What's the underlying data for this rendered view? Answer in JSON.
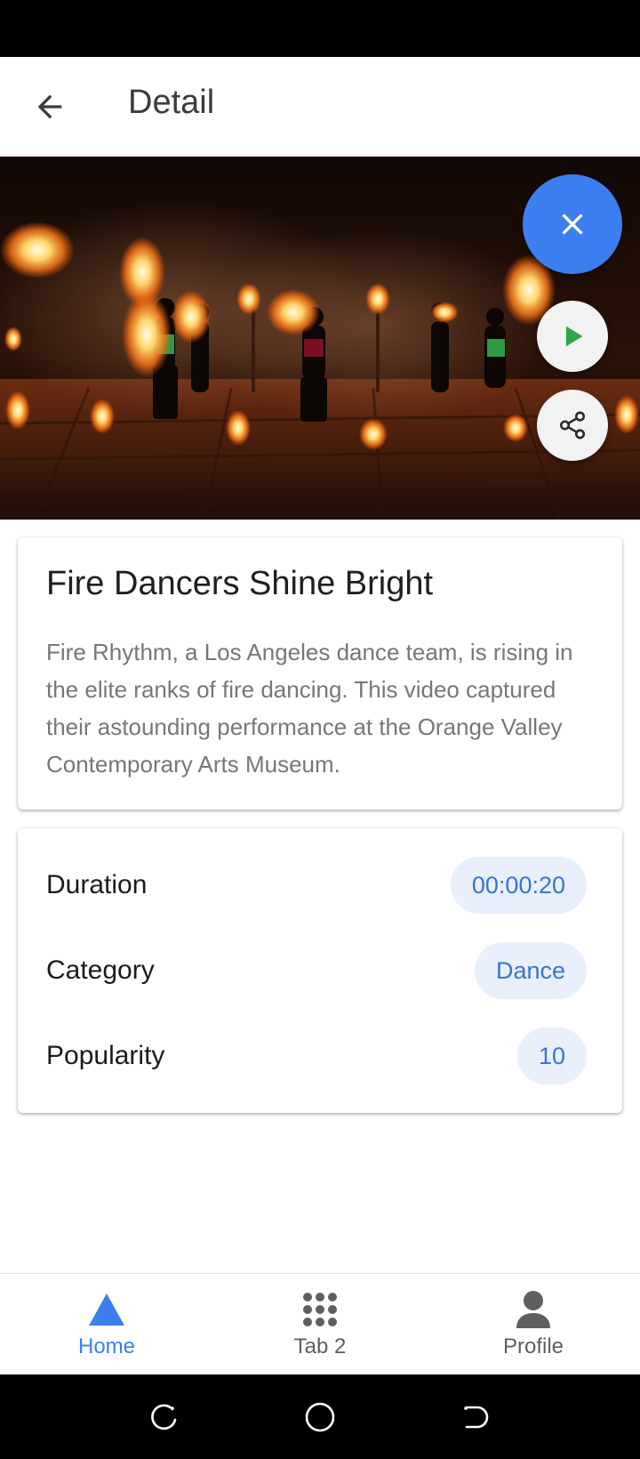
{
  "app_bar": {
    "back_icon": "arrow-back-icon",
    "title": "Detail"
  },
  "media": {
    "description_icon": "video-thumbnail",
    "actions": {
      "close_icon": "close-icon",
      "play_icon": "play-icon",
      "share_icon": "share-icon"
    }
  },
  "detail": {
    "title": "Fire Dancers Shine Bright",
    "description": "Fire Rhythm, a Los Angeles dance team, is rising in the elite ranks of fire dancing. This video captured their astounding performance at the Orange Valley Contemporary Arts Museum."
  },
  "info": {
    "rows": [
      {
        "label": "Duration",
        "value": "00:00:20"
      },
      {
        "label": "Category",
        "value": "Dance"
      },
      {
        "label": "Popularity",
        "value": "10"
      }
    ]
  },
  "bottom_nav": {
    "items": [
      {
        "label": "Home",
        "icon": "home-triangle-icon",
        "active": true
      },
      {
        "label": "Tab 2",
        "icon": "apps-grid-icon",
        "active": false
      },
      {
        "label": "Profile",
        "icon": "person-icon",
        "active": false
      }
    ]
  },
  "colors": {
    "accent": "#3b7ff1",
    "chip_bg": "#e9f0fc",
    "chip_text": "#3a73d6",
    "inactive_nav": "#5f5f5f",
    "play_green": "#2ca84a"
  }
}
